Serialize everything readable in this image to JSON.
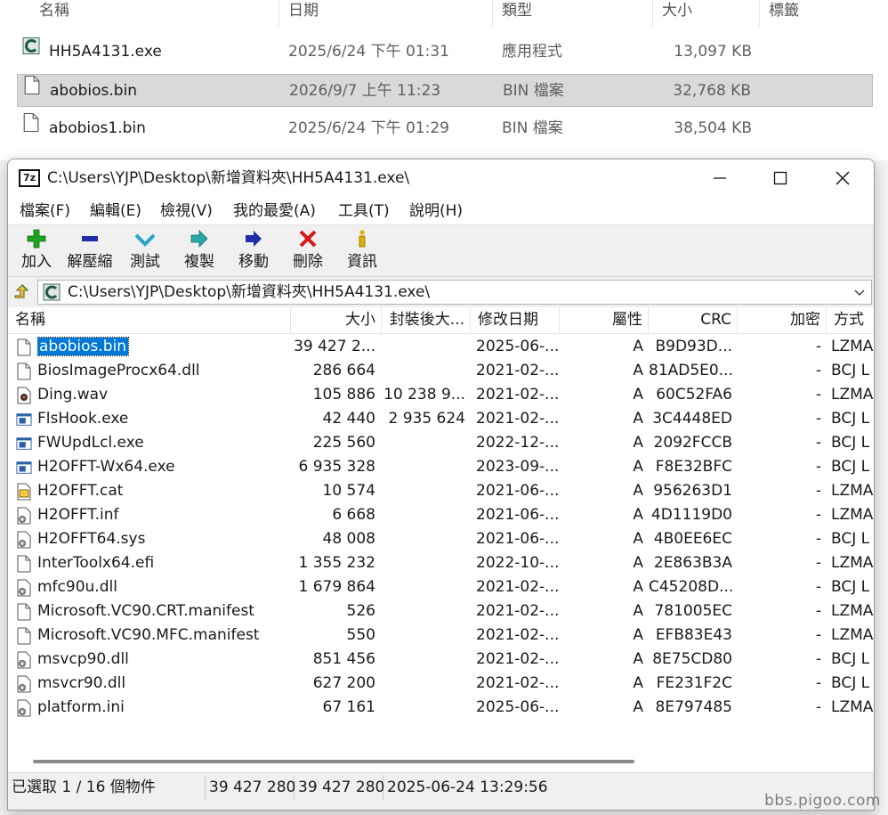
{
  "explorer": {
    "columns": [
      "名稱",
      "日期",
      "類型",
      "大小",
      "標籤"
    ],
    "files": [
      {
        "name": "HH5A4131.exe",
        "date": "2025/6/24 下午 01:31",
        "type": "應用程式",
        "size": "13,097 KB",
        "icon": "app-icon",
        "selected": false
      },
      {
        "name": "abobios.bin",
        "date": "2026/9/7 上午 11:23",
        "type": "BIN 檔案",
        "size": "32,768 KB",
        "icon": "file-icon",
        "selected": true
      },
      {
        "name": "abobios1.bin",
        "date": "2025/6/24 下午 01:29",
        "type": "BIN 檔案",
        "size": "38,504 KB",
        "icon": "file-icon",
        "selected": false
      }
    ]
  },
  "window": {
    "logo": "7z",
    "title": "C:\\Users\\YJP\\Desktop\\新增資料夾\\HH5A4131.exe\\",
    "minimize": "—",
    "maximize": "☐",
    "close": "✕"
  },
  "menu": [
    "檔案(F)",
    "編輯(E)",
    "檢視(V)",
    "我的最愛(A)",
    "工具(T)",
    "說明(H)"
  ],
  "toolbar": [
    {
      "label": "加入",
      "icon": "plus-icon",
      "color": "#1ea31e"
    },
    {
      "label": "解壓縮",
      "icon": "minus-icon",
      "color": "#1f2ea8"
    },
    {
      "label": "測試",
      "icon": "check-icon",
      "color": "#27a5c3"
    },
    {
      "label": "複製",
      "icon": "copy-arrow-icon",
      "color": "#2aa7a7"
    },
    {
      "label": "移動",
      "icon": "move-arrow-icon",
      "color": "#1f2ea8"
    },
    {
      "label": "刪除",
      "icon": "delete-x-icon",
      "color": "#d21a1a"
    },
    {
      "label": "資訊",
      "icon": "info-icon",
      "color": "#e0b000"
    }
  ],
  "address": {
    "path": "C:\\Users\\YJP\\Desktop\\新增資料夾\\HH5A4131.exe\\"
  },
  "list": {
    "headers": {
      "name": "名稱",
      "size": "大小",
      "packed": "封裝後大...",
      "modified": "修改日期",
      "attr": "屬性",
      "crc": "CRC",
      "encrypted": "加密",
      "method": "方式"
    },
    "rows": [
      {
        "name": "abobios.bin",
        "size": "39 427 2...",
        "packed": "",
        "modified": "2025-06-...",
        "attr": "A",
        "crc": "B9D93D...",
        "encrypted": "-",
        "method": "LZMA",
        "icon": "file-icon",
        "selected": true
      },
      {
        "name": "BiosImageProcx64.dll",
        "size": "286 664",
        "packed": "",
        "modified": "2021-02-...",
        "attr": "A",
        "crc": "81AD5E0...",
        "encrypted": "-",
        "method": "BCJ L",
        "icon": "file-icon",
        "selected": false
      },
      {
        "name": "Ding.wav",
        "size": "105 886",
        "packed": "10 238 9...",
        "modified": "2021-02-...",
        "attr": "A",
        "crc": "60C52FA6",
        "encrypted": "-",
        "method": "LZMA",
        "icon": "audio-icon",
        "selected": false
      },
      {
        "name": "FlsHook.exe",
        "size": "42 440",
        "packed": "2 935 624",
        "modified": "2021-02-...",
        "attr": "A",
        "crc": "3C4448ED",
        "encrypted": "-",
        "method": "BCJ L",
        "icon": "exe-icon",
        "selected": false
      },
      {
        "name": "FWUpdLcl.exe",
        "size": "225 560",
        "packed": "",
        "modified": "2022-12-...",
        "attr": "A",
        "crc": "2092FCCB",
        "encrypted": "-",
        "method": "BCJ L",
        "icon": "exe-icon",
        "selected": false
      },
      {
        "name": "H2OFFT-Wx64.exe",
        "size": "6 935 328",
        "packed": "",
        "modified": "2023-09-...",
        "attr": "A",
        "crc": "F8E32BFC",
        "encrypted": "-",
        "method": "BCJ L",
        "icon": "exe-icon",
        "selected": false
      },
      {
        "name": "H2OFFT.cat",
        "size": "10 574",
        "packed": "",
        "modified": "2021-06-...",
        "attr": "A",
        "crc": "956263D1",
        "encrypted": "-",
        "method": "LZMA",
        "icon": "cat-icon",
        "selected": false
      },
      {
        "name": "H2OFFT.inf",
        "size": "6 668",
        "packed": "",
        "modified": "2021-06-...",
        "attr": "A",
        "crc": "4D1119D0",
        "encrypted": "-",
        "method": "LZMA",
        "icon": "settings-file-icon",
        "selected": false
      },
      {
        "name": "H2OFFT64.sys",
        "size": "48 008",
        "packed": "",
        "modified": "2021-06-...",
        "attr": "A",
        "crc": "4B0EE6EC",
        "encrypted": "-",
        "method": "BCJ L",
        "icon": "settings-file-icon",
        "selected": false
      },
      {
        "name": "InterToolx64.efi",
        "size": "1 355 232",
        "packed": "",
        "modified": "2022-10-...",
        "attr": "A",
        "crc": "2E863B3A",
        "encrypted": "-",
        "method": "LZMA",
        "icon": "file-icon",
        "selected": false
      },
      {
        "name": "mfc90u.dll",
        "size": "1 679 864",
        "packed": "",
        "modified": "2021-02-...",
        "attr": "A",
        "crc": "C45208D...",
        "encrypted": "-",
        "method": "BCJ L",
        "icon": "settings-file-icon",
        "selected": false
      },
      {
        "name": "Microsoft.VC90.CRT.manifest",
        "size": "526",
        "packed": "",
        "modified": "2021-02-...",
        "attr": "A",
        "crc": "781005EC",
        "encrypted": "-",
        "method": "LZMA",
        "icon": "file-icon",
        "selected": false
      },
      {
        "name": "Microsoft.VC90.MFC.manifest",
        "size": "550",
        "packed": "",
        "modified": "2021-02-...",
        "attr": "A",
        "crc": "EFB83E43",
        "encrypted": "-",
        "method": "LZMA",
        "icon": "file-icon",
        "selected": false
      },
      {
        "name": "msvcp90.dll",
        "size": "851 456",
        "packed": "",
        "modified": "2021-02-...",
        "attr": "A",
        "crc": "8E75CD80",
        "encrypted": "-",
        "method": "BCJ L",
        "icon": "settings-file-icon",
        "selected": false
      },
      {
        "name": "msvcr90.dll",
        "size": "627 200",
        "packed": "",
        "modified": "2021-02-...",
        "attr": "A",
        "crc": "FE231F2C",
        "encrypted": "-",
        "method": "BCJ L",
        "icon": "settings-file-icon",
        "selected": false
      },
      {
        "name": "platform.ini",
        "size": "67 161",
        "packed": "",
        "modified": "2025-06-...",
        "attr": "A",
        "crc": "8E797485",
        "encrypted": "-",
        "method": "LZMA",
        "icon": "settings-file-icon",
        "selected": false
      }
    ]
  },
  "status": {
    "selection": "已選取 1 / 16 個物件",
    "size": "39 427 280",
    "packed": "39 427 280",
    "modified": "2025-06-24 13:29:56"
  },
  "watermark": "bbs.pigoo.com",
  "colors": {
    "selection": "#0078d7",
    "explorer_selected_row": "#d9d9d9"
  }
}
